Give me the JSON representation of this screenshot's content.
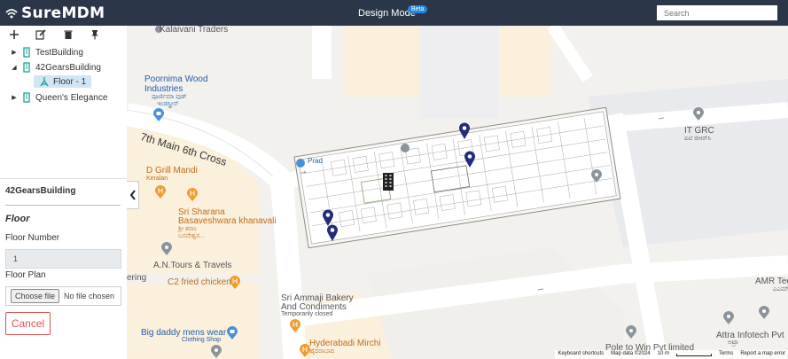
{
  "app": {
    "brand": "SureMDM",
    "mode_title": "Design Mode",
    "beta_badge": "Beta"
  },
  "search": {
    "placeholder": "Search"
  },
  "toolbar": {
    "icons": [
      "plus-icon",
      "edit-icon",
      "trash-icon",
      "pin-icon"
    ]
  },
  "tree": {
    "items": [
      {
        "label": "TestBuilding",
        "expanded": false
      },
      {
        "label": "42GearsBuilding",
        "expanded": true
      },
      {
        "label": "Floor - 1",
        "selected": true
      },
      {
        "label": "Queen's Elegance",
        "expanded": false
      }
    ]
  },
  "properties": {
    "title": "42GearsBuilding",
    "section": "Floor",
    "floor_number_label": "Floor Number",
    "floor_number_value": "1",
    "floor_plan_label": "Floor Plan",
    "choose_file": "Choose file",
    "no_file": "No file chosen",
    "cancel": "Cancel"
  },
  "map": {
    "labels": {
      "kalaivani": "Kalaivani Traders",
      "poornima": "Poornima Wood",
      "poornima2": "Industries",
      "poornima3": "ಪೂರ್ಣಿಮಾ ವುಡ್",
      "poornima4": "ಇಂಡಸ್ಟ್ರೀಸ್",
      "road": "7th Main 6th Cross",
      "dgrill": "D Grill Mandi",
      "dgrill2": "Keralan",
      "sharana": "Sri Sharana",
      "sharana2": "Basaveshwara khanavali",
      "sharana3": "ಶ್ರೀ ಶರಣ",
      "sharana4": "ಬಸವೇಶ್ವರ...",
      "antours": "A.N.Tours & Travels",
      "c2": "C2 fried chicken",
      "ering": "ering",
      "ammaji": "Sri Ammaji Bakery",
      "ammaji2": "And Condiments",
      "ammaji3": "Temporarily closed",
      "bigdaddy": "Big daddy mens wear",
      "bigdaddy2": "Clothing Shop",
      "hyderabadi": "Hyderabadi Mirchi",
      "hyderabadi2": "ಹೈದರಾಬಾದಿ",
      "itgrc": "IT GRC",
      "itgrc2": "ಐಟಿ ಜಿಆರ್‌ಸಿ",
      "amr": "AMR Tec",
      "amr2": "ಎಎಮ್‌ಆರ್",
      "attra": "Attra Infotech Pvt",
      "attra2": "ಅಟ್ರಾ",
      "pole": "Pole to Win Pvt limited",
      "prad": "Prad"
    },
    "footer": {
      "shortcuts": "Keyboard shortcuts",
      "mapdata": "Map data ©2024",
      "scale": "10 m",
      "terms": "Terms",
      "report": "Report a map error"
    }
  }
}
